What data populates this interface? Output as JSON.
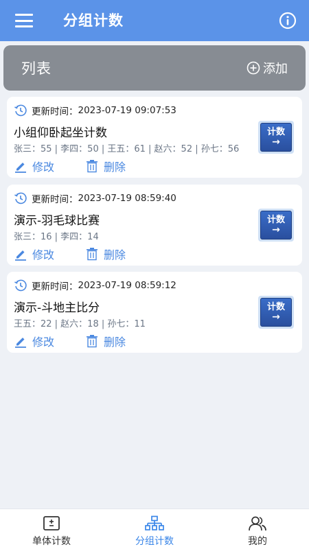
{
  "topbar": {
    "title": "分组计数",
    "menu_icon": "menu-icon",
    "info_icon": "info-icon",
    "color": "#5b93e8"
  },
  "list_header": {
    "title": "列表",
    "add_label": "添加",
    "add_icon": "plus-circle-icon"
  },
  "cards": [
    {
      "time_label": "更新时间：",
      "time": "2023-07-19 09:07:53",
      "title": "小组仰卧起坐计数",
      "scores": "张三：55 | 李四：50 | 王五：61 | 赵六：52 | 孙七：56",
      "edit_label": "修改",
      "delete_label": "删除",
      "count_label": "计数",
      "count_arrow": "→"
    },
    {
      "time_label": "更新时间：",
      "time": "2023-07-19 08:59:40",
      "title": "演示-羽毛球比赛",
      "scores": "张三：16 | 李四：14",
      "edit_label": "修改",
      "delete_label": "删除",
      "count_label": "计数",
      "count_arrow": "→"
    },
    {
      "time_label": "更新时间：",
      "time": "2023-07-19 08:59:12",
      "title": "演示-斗地主比分",
      "scores": "王五：22 | 赵六：18 | 孙七：11",
      "edit_label": "修改",
      "delete_label": "删除",
      "count_label": "计数",
      "count_arrow": "→"
    }
  ],
  "bottom_nav": {
    "items": [
      {
        "label": "单体计数",
        "icon": "single-counter-icon",
        "active": false
      },
      {
        "label": "分组计数",
        "icon": "group-tree-icon",
        "active": true
      },
      {
        "label": "我的",
        "icon": "user-icon",
        "active": false
      }
    ],
    "active_color": "#3a86e8"
  }
}
